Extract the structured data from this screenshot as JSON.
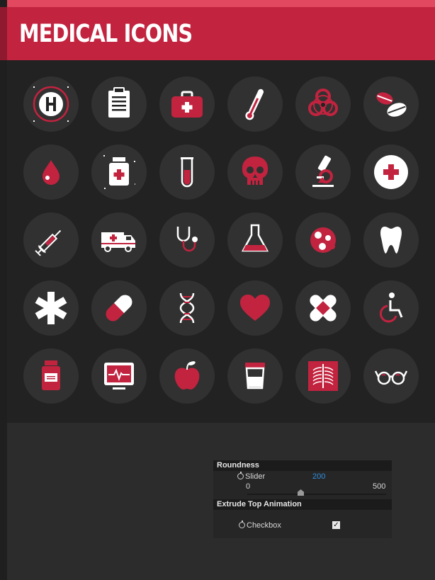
{
  "header": {
    "title": "MEDICAL ICONS"
  },
  "icons": [
    "hospital-sign-icon",
    "clipboard-icon",
    "first-aid-kit-icon",
    "thermometer-icon",
    "biohazard-icon",
    "pills-icon",
    "blood-drop-icon",
    "medicine-bottle-icon",
    "test-tube-icon",
    "skull-icon",
    "microscope-icon",
    "red-cross-icon",
    "syringe-icon",
    "ambulance-icon",
    "stethoscope-icon",
    "flask-icon",
    "virus-cells-icon",
    "tooth-icon",
    "star-of-life-icon",
    "capsule-icon",
    "dna-icon",
    "heart-icon",
    "bandage-icon",
    "wheelchair-icon",
    "prescription-bottle-icon",
    "heart-monitor-icon",
    "apple-icon",
    "specimen-cup-icon",
    "xray-icon",
    "glasses-icon"
  ],
  "colors": {
    "accent": "#c2233f",
    "panel": "#222222",
    "icon_bg": "#313131",
    "white": "#ffffff",
    "link_value": "#2f8fe0"
  },
  "controls": {
    "section1": "Roundness",
    "slider_label": "Slider",
    "slider_value": "200",
    "slider_min": "0",
    "slider_max": "500",
    "section2": "Extrude Top Animation",
    "checkbox_label": "Checkbox",
    "checkbox_checked": true
  }
}
